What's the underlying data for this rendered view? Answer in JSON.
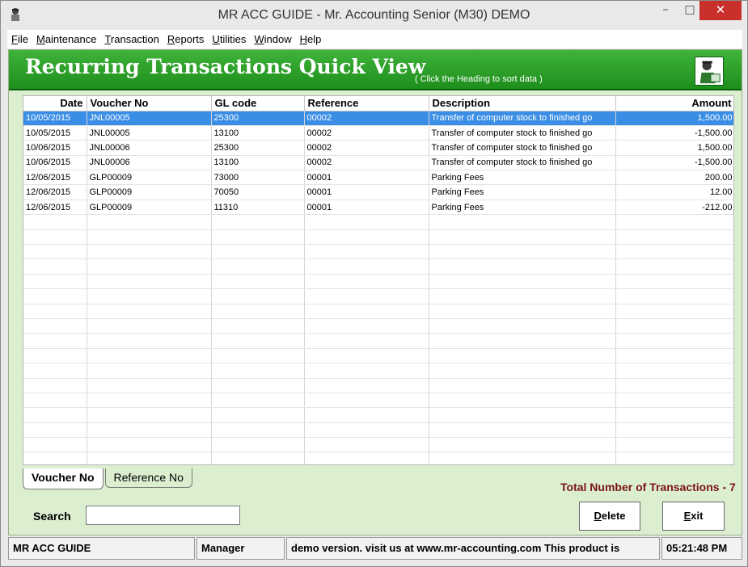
{
  "window": {
    "title": "MR ACC GUIDE - Mr. Accounting Senior (M30) DEMO",
    "min_glyph": "–",
    "max_glyph": "□",
    "close_glyph": "✕"
  },
  "menu": [
    {
      "accel": "F",
      "rest": "ile"
    },
    {
      "accel": "M",
      "rest": "aintenance"
    },
    {
      "accel": "T",
      "rest": "ransaction"
    },
    {
      "accel": "R",
      "rest": "eports"
    },
    {
      "accel": "U",
      "rest": "tilities"
    },
    {
      "accel": "W",
      "rest": "indow"
    },
    {
      "accel": "H",
      "rest": "elp"
    }
  ],
  "header": {
    "title": "Recurring Transactions Quick View",
    "hint": "( Click the Heading to sort data )"
  },
  "table": {
    "columns": [
      "Date",
      "Voucher No",
      "GL code",
      "Reference",
      "Description",
      "Amount"
    ],
    "rows": [
      [
        "10/05/2015",
        "JNL00005",
        "25300",
        "00002",
        "Transfer of computer stock to finished go",
        "1,500.00"
      ],
      [
        "10/05/2015",
        "JNL00005",
        "13100",
        "00002",
        "Transfer of computer stock to finished go",
        "-1,500.00"
      ],
      [
        "10/06/2015",
        "JNL00006",
        "25300",
        "00002",
        "Transfer of computer stock to finished go",
        "1,500.00"
      ],
      [
        "10/06/2015",
        "JNL00006",
        "13100",
        "00002",
        "Transfer of computer stock to finished go",
        "-1,500.00"
      ],
      [
        "12/06/2015",
        "GLP00009",
        "73000",
        "00001",
        "Parking Fees",
        "200.00"
      ],
      [
        "12/06/2015",
        "GLP00009",
        "70050",
        "00001",
        "Parking Fees",
        "12.00"
      ],
      [
        "12/06/2015",
        "GLP00009",
        "11310",
        "00001",
        "Parking Fees",
        "-212.00"
      ]
    ],
    "selected_row": 0,
    "empty_rows": 17
  },
  "tabs": [
    "Voucher No",
    "Reference No"
  ],
  "total_text": "Total Number of Transactions - 7",
  "search": {
    "label": "Search",
    "value": ""
  },
  "buttons": {
    "delete": {
      "accel": "D",
      "rest": "elete"
    },
    "exit": {
      "accel": "E",
      "rest": "xit"
    }
  },
  "status": {
    "app": "MR ACC GUIDE",
    "user": "Manager",
    "message": "demo version.  visit us at www.mr-accounting.com This product is",
    "time": "05:21:48 PM"
  },
  "colors": {
    "header_green": "#2ea52a",
    "client_bg": "#dbeed0",
    "selected_row": "#3a8ee6",
    "total_text": "#7a1414",
    "close_button": "#c9302c"
  }
}
